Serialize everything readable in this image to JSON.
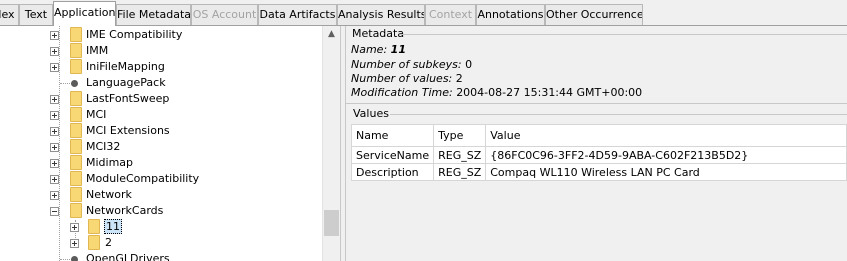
{
  "tabs": [
    {
      "label": "lex",
      "state": "normal"
    },
    {
      "label": "Text",
      "state": "normal"
    },
    {
      "label": "Application",
      "state": "selected"
    },
    {
      "label": "File Metadata",
      "state": "normal"
    },
    {
      "label": "OS Account",
      "state": "disabled"
    },
    {
      "label": "Data Artifacts",
      "state": "normal"
    },
    {
      "label": "Analysis Results",
      "state": "normal"
    },
    {
      "label": "Context",
      "state": "disabled"
    },
    {
      "label": "Annotations",
      "state": "normal"
    },
    {
      "label": "Other Occurrences",
      "state": "normal"
    }
  ],
  "tree": {
    "nodes": [
      {
        "label": "IME Compatibility",
        "expandable": true
      },
      {
        "label": "IMM",
        "expandable": true
      },
      {
        "label": "IniFileMapping",
        "expandable": true
      },
      {
        "label": "LanguagePack",
        "expandable": false
      },
      {
        "label": "LastFontSweep",
        "expandable": true
      },
      {
        "label": "MCI",
        "expandable": true
      },
      {
        "label": "MCI Extensions",
        "expandable": true
      },
      {
        "label": "MCI32",
        "expandable": true
      },
      {
        "label": "Midimap",
        "expandable": true
      },
      {
        "label": "ModuleCompatibility",
        "expandable": true
      },
      {
        "label": "Network",
        "expandable": true
      },
      {
        "label": "NetworkCards",
        "expandable": true,
        "expanded": true
      },
      {
        "label": "11",
        "expandable": true,
        "child": true,
        "selected": true
      },
      {
        "label": "2",
        "expandable": true,
        "child": true
      },
      {
        "label": "OpenGLDrivers",
        "expandable": false
      }
    ]
  },
  "metadata": {
    "group_title": "Metadata",
    "name_label": "Name:",
    "name_value": "11",
    "subkeys_label": "Number of subkeys:",
    "subkeys_value": "0",
    "values_label": "Number of values:",
    "values_value": "2",
    "modtime_label": "Modification Time:",
    "modtime_value": "2004-08-27 15:31:44 GMT+00:00"
  },
  "values": {
    "group_title": "Values",
    "columns": [
      "Name",
      "Type",
      "Value"
    ],
    "rows": [
      [
        "ServiceName",
        "REG_SZ",
        "{86FC0C96-3FF2-4D59-9ABA-C602F213B5D2}"
      ],
      [
        "Description",
        "REG_SZ",
        "Compaq WL110 Wireless LAN PC Card"
      ]
    ]
  }
}
